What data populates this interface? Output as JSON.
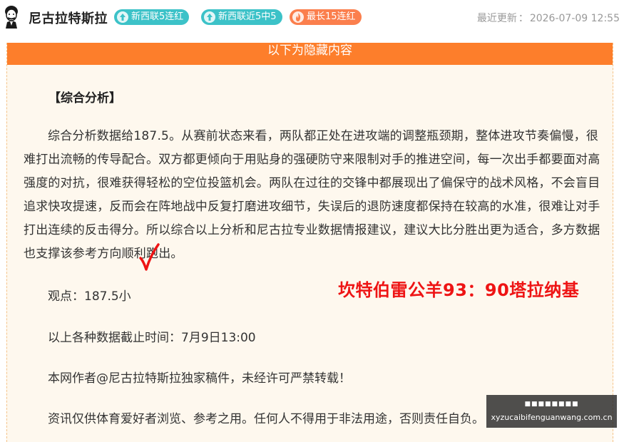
{
  "header": {
    "author_name": "尼古拉特斯拉",
    "badges": [
      {
        "label": "新西联5连红",
        "icon": "arrow-up-icon",
        "color": "#3cc2c8"
      },
      {
        "label": "新西联近5中5",
        "icon": "arrow-up-icon",
        "color": "#3cc2c8"
      },
      {
        "label": "最长15连红",
        "icon": "flame-icon",
        "color": "#fb7f4d"
      }
    ],
    "updated_label": "最近更新",
    "updated_sep": "：",
    "updated_time": "2026-07-09 12:55"
  },
  "content": {
    "hidden_banner": "以下为隐藏内容",
    "section_title": "【综合分析】",
    "analysis": "综合分析数据给187.5。从赛前状态来看，两队都正处在进攻端的调整瓶颈期，整体进攻节奏偏慢，很难打出流畅的传导配合。双方都更倾向于用贴身的强硬防守来限制对手的推进空间，每一次出手都要面对高强度的对抗，很难获得轻松的空位投篮机会。两队在过往的交锋中都展现出了偏保守的战术风格，不会盲目追求快攻提速，反而会在阵地战中反复打磨进攻细节，失误后的退防速度都保持在较高的水准，很难让对手打出连续的反击得分。所以综合以上分析和尼古拉专业数据情报建议，建议大比分胜出更为适合，多方数据也支撑该参考方向顺利跑出。",
    "pick": "观点：187.5小",
    "cutoff": "以上各种数据截止时间：7月9日13:00",
    "copyright": "本网作者@尼古拉特斯拉独家稿件，未经许可严禁转载！",
    "disclaimer": "资讯仅供体育爱好者浏览、参考之用。任何人不得用于非法用途，否则责任自负。"
  },
  "overlay": {
    "score": "坎特伯雷公羊93：90塔拉纳基",
    "score_color": "#ee1414",
    "checkmark_color": "#ee1414"
  },
  "watermark": {
    "top_text": "■■■■■■■■",
    "url": "xyzucaibifenguanwang.com.cn"
  }
}
